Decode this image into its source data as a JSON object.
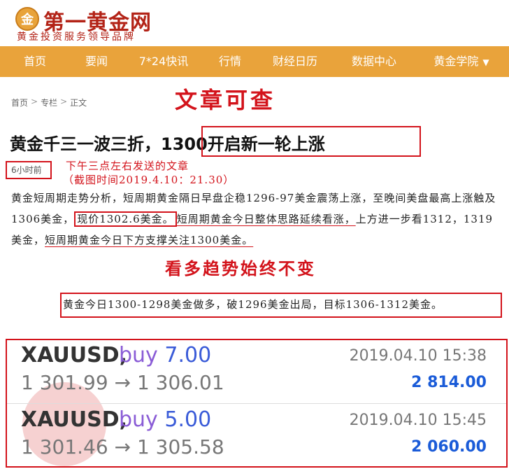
{
  "logo": {
    "icon_char": "金",
    "name": "第一黄金网",
    "slogan": "黄金投资服务领导品牌"
  },
  "nav": {
    "items": [
      "首页",
      "要闻",
      "7*24快讯",
      "行情",
      "财经日历",
      "数据中心",
      "黄金学院"
    ]
  },
  "breadcrumb": [
    "首页",
    "专栏",
    "正文"
  ],
  "annotations": {
    "article_check": "文章可查",
    "sent_note": "下午三点左右发送的文章",
    "capture_time": "（截图时间2019.4.10：21.30）",
    "trend": "看多趋势始终不变"
  },
  "article": {
    "title_a": "黄金千三一波三折，",
    "title_b": "1300开启新一轮上涨",
    "time": "6小时前",
    "p1_a": "黄金短周期走势分析，短周期黄金隔日早盘企稳1296-97美金震荡上涨，至晚间美盘最高上涨触及1306美金，",
    "p1_b": "现价1302.6美金。",
    "p1_c": "短周期黄金今日整体思路延续看涨，",
    "p1_d": "上方进一步看1312，1319美金，",
    "p1_e": "短周期黄金今日下方支撑关注1300美金。",
    "p2": "黄金今日1300-1298美金做多，破1296美金出局，目标1306-1312美金。"
  },
  "trades": [
    {
      "symbol": "XAUUSD,",
      "side": "buy",
      "lots": "7.00",
      "prices": "1 301.99 → 1 306.01",
      "date": "2019.04.10 15:38",
      "profit": "2 814.00"
    },
    {
      "symbol": "XAUUSD,",
      "side": "buy",
      "lots": "5.00",
      "prices": "1 301.46 → 1 305.58",
      "date": "2019.04.10 15:45",
      "profit": "2 060.00"
    }
  ]
}
